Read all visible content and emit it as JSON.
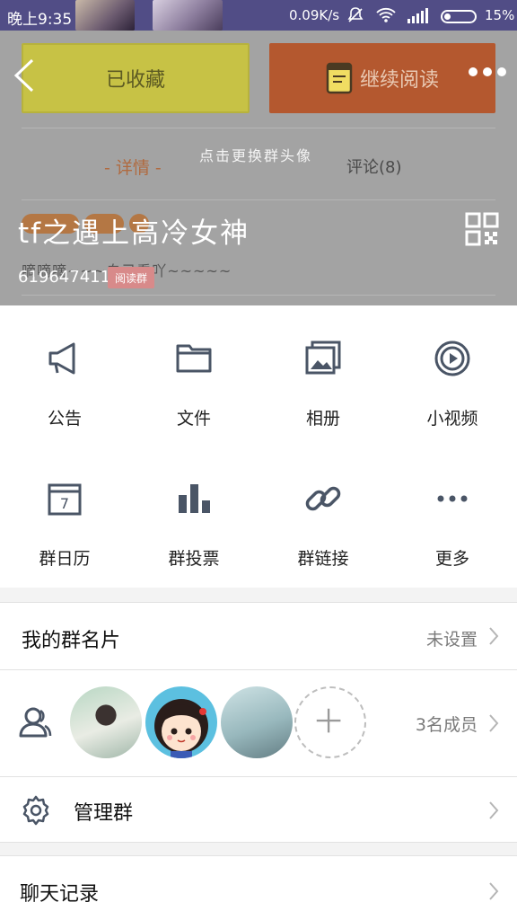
{
  "status_bar": {
    "time": "晚上9:35",
    "speed": "0.09K/s",
    "battery": "15%"
  },
  "top_actions": {
    "favorite_label": "已收藏",
    "continue_reading_label": "继续阅读"
  },
  "tabs": {
    "details": "- 详情 -",
    "comments": "评论(8)"
  },
  "hint": "点击更换群头像",
  "group": {
    "name": "tf之遇上高冷女神",
    "description": "嘀嘀嘀~~~自己看吖~~~~~",
    "id": "619647411",
    "badge": "阅读群"
  },
  "functions": [
    {
      "label": "公告",
      "icon": "megaphone-icon"
    },
    {
      "label": "文件",
      "icon": "folder-icon"
    },
    {
      "label": "相册",
      "icon": "album-icon"
    },
    {
      "label": "小视频",
      "icon": "video-icon"
    },
    {
      "label": "群日历",
      "icon": "calendar-icon"
    },
    {
      "label": "群投票",
      "icon": "vote-chart-icon"
    },
    {
      "label": "群链接",
      "icon": "link-icon"
    },
    {
      "label": "更多",
      "icon": "more-icon"
    }
  ],
  "calendar_day": "7",
  "my_card": {
    "label": "我的群名片",
    "value": "未设置"
  },
  "members": {
    "count_label": "3名成员"
  },
  "manage": {
    "label": "管理群"
  },
  "chat_history": {
    "label": "聊天记录"
  }
}
